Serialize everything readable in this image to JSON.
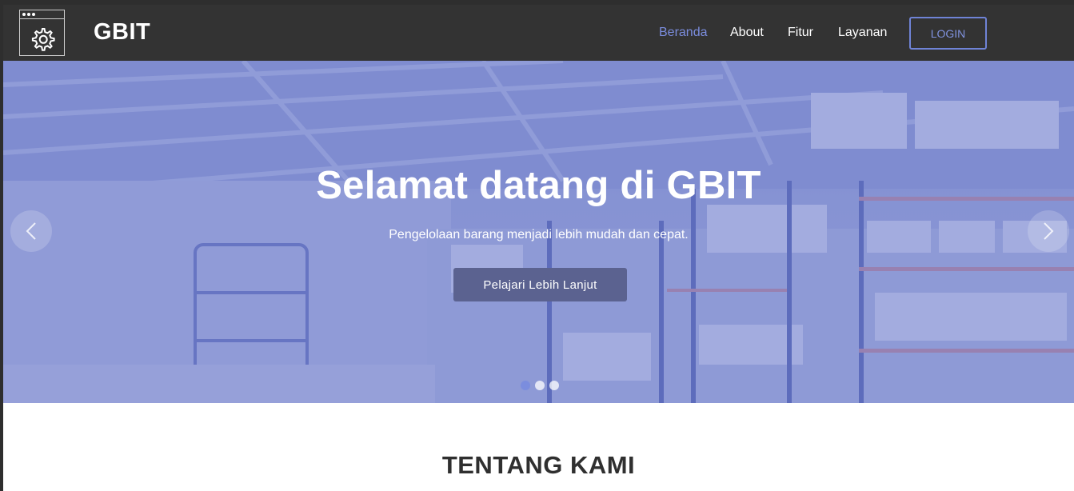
{
  "navbar": {
    "brand": "GBIT",
    "items": [
      {
        "label": "Beranda",
        "active": true
      },
      {
        "label": "About",
        "active": false
      },
      {
        "label": "Fitur",
        "active": false
      },
      {
        "label": "Layanan",
        "active": false
      }
    ],
    "login_label": "LOGIN",
    "logo_icon": "gear-window-icon"
  },
  "hero": {
    "title": "Selamat datang di GBIT",
    "subtitle": "Pengelolaan barang menjadi lebih mudah dan cepat.",
    "cta_label": "Pelajari Lebih Lanjut",
    "slides_count": 3,
    "active_slide": 1,
    "prev_icon": "chevron-left-icon",
    "next_icon": "chevron-right-icon"
  },
  "about": {
    "title": "TENTANG KAMI"
  },
  "colors": {
    "navbar_bg": "#333333",
    "accent": "#7b8dde",
    "cta_bg": "#5b6290"
  }
}
